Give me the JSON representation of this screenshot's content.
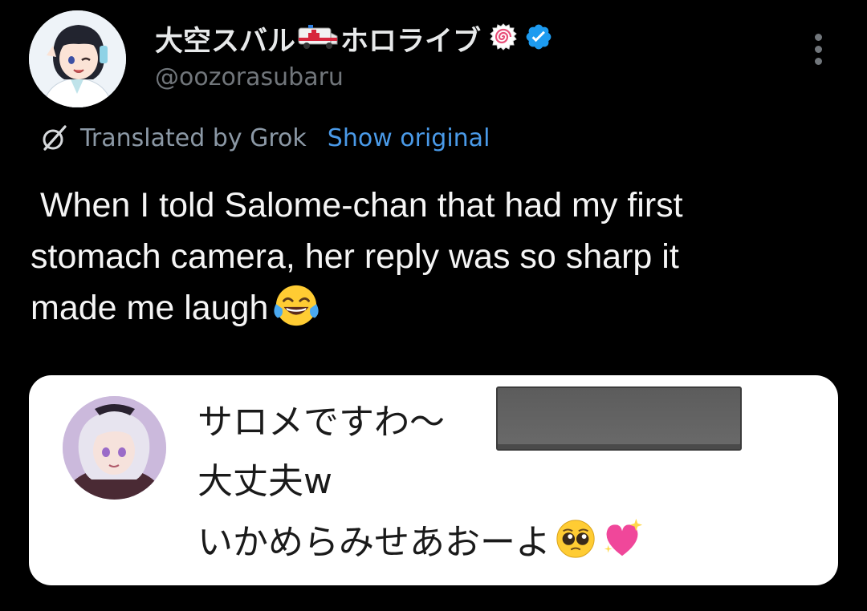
{
  "post": {
    "display_name": "大空スバル",
    "display_name_suffix": "ホロライブ",
    "name_emoji_1": "ambulance-icon",
    "name_emoji_2": "naruto-swirl-icon",
    "verified_badge": "verified-badge-icon",
    "handle": "@oozorasubaru",
    "more_icon": "more-vertical-icon",
    "translation": {
      "label": "Translated by Grok",
      "show_original": "Show original",
      "icon": "grok-icon"
    },
    "text_lines": [
      " When I told Salome-chan that had my first",
      "stomach camera, her reply was so sharp it",
      "made me laugh"
    ],
    "text_emoji": "face-with-tears-of-joy-icon"
  },
  "media_card": {
    "sender_name": "サロメですわ〜",
    "message_line1": "大丈夫w",
    "message_line2": "いかめらみせあおーよ",
    "message_emojis": [
      "pleading-face-icon",
      "sparkling-heart-icon"
    ]
  },
  "colors": {
    "background": "#000000",
    "primary_text": "#e7e9ea",
    "secondary_text": "#71767b",
    "link": "#4a9ae8",
    "verified": "#1d9bf0",
    "card_background": "#ffffff"
  }
}
